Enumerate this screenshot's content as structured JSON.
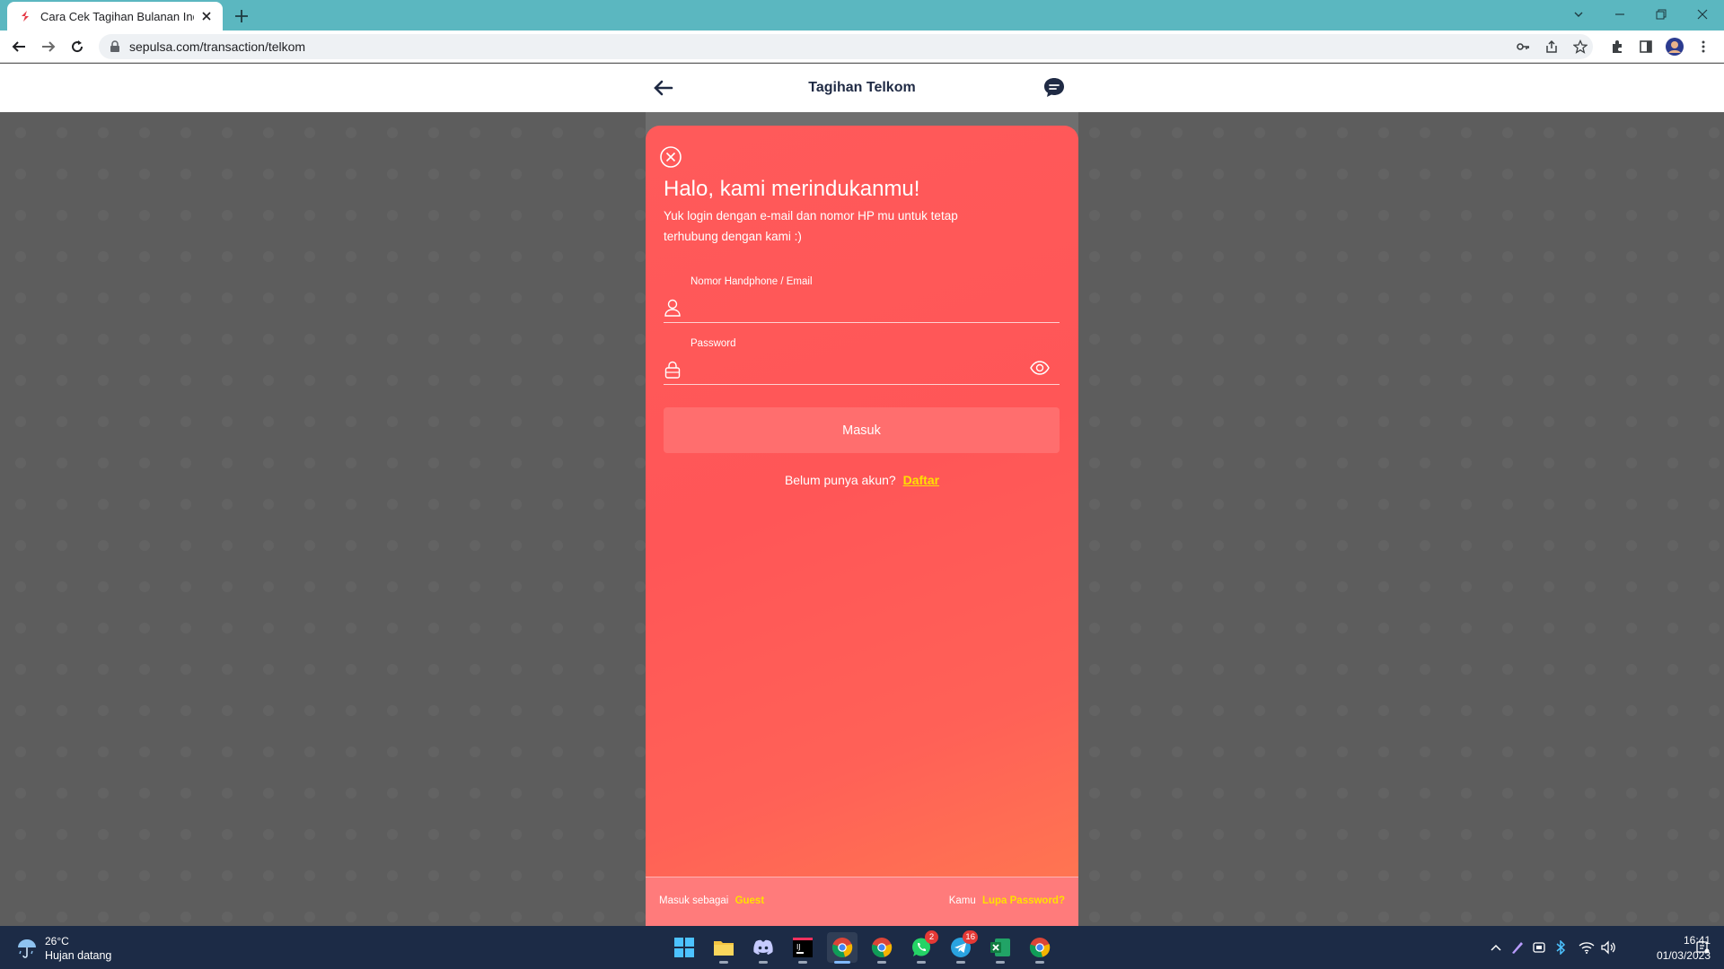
{
  "browser": {
    "tab_title": "Cara Cek Tagihan Bulanan Indiho",
    "url": "sepulsa.com/transaction/telkom"
  },
  "page": {
    "header_title": "Tagihan Telkom"
  },
  "login_modal": {
    "title": "Halo, kami merindukanmu!",
    "subtitle": "Yuk login dengan e-mail dan nomor HP mu untuk tetap terhubung dengan kami :)",
    "identifier_label": "Nomor Handphone / Email",
    "identifier_value": "",
    "password_label": "Password",
    "password_value": "",
    "submit_label": "Masuk",
    "register_prompt": "Belum punya akun?",
    "register_link": "Daftar",
    "guest_prompt": "Masuk sebagai",
    "guest_link": "Guest",
    "forgot_prompt": "Kamu",
    "forgot_link": "Lupa Password?"
  },
  "colors": {
    "modal_primary": "#ff5a5a",
    "link_yellow": "#ffe000",
    "tabbar": "#5bb7c0",
    "taskbar": "#1c2b46"
  },
  "taskbar": {
    "weather_temp": "26°C",
    "weather_desc": "Hujan datang",
    "apps": [
      {
        "name": "windows-start-icon"
      },
      {
        "name": "file-explorer-icon"
      },
      {
        "name": "discord-icon"
      },
      {
        "name": "intellij-icon"
      },
      {
        "name": "chrome-icon",
        "active": true
      },
      {
        "name": "chrome-icon",
        "badge": ""
      },
      {
        "name": "whatsapp-icon",
        "badge": "2"
      },
      {
        "name": "telegram-icon",
        "badge": "16"
      },
      {
        "name": "excel-icon"
      },
      {
        "name": "chrome-icon"
      }
    ],
    "clock_time": "16:41",
    "clock_date": "01/03/2023"
  }
}
